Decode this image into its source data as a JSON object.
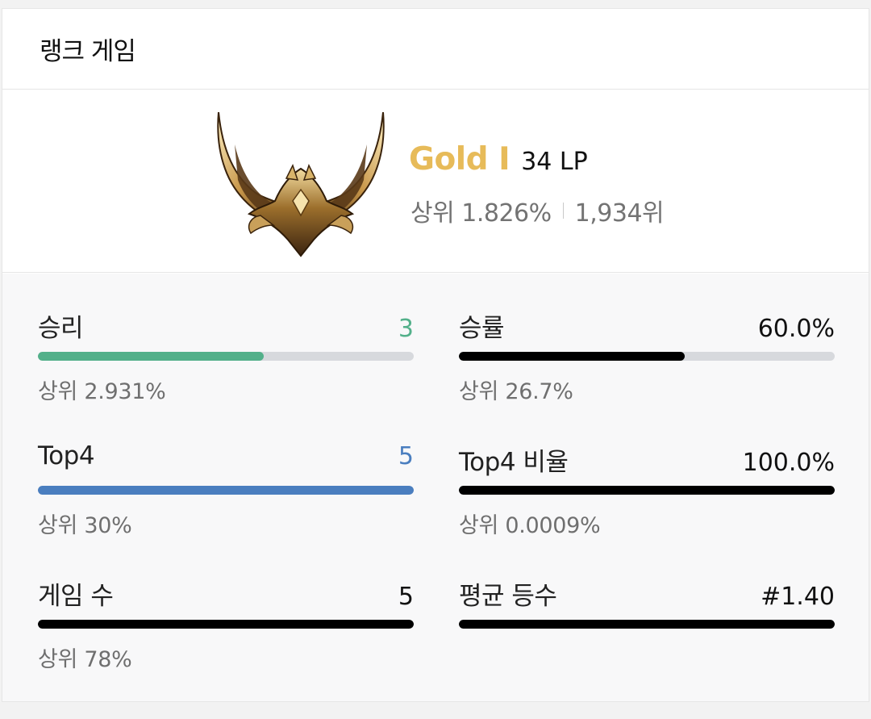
{
  "header": {
    "title": "랭크 게임"
  },
  "rank": {
    "emblem_icon": "gold-tier-emblem-icon",
    "tier": "Gold I",
    "lp": "34 LP",
    "percentile": "상위 1.826%",
    "position": "1,934위",
    "tier_color": "#e7bb59"
  },
  "stats": {
    "wins": {
      "label": "승리",
      "value": "3",
      "fill": 0.6,
      "sub": "상위 2.931%",
      "color": "#53b08a",
      "value_color": "#53b08a"
    },
    "win_rate": {
      "label": "승률",
      "value": "60.0%",
      "fill": 0.6,
      "sub": "상위 26.7%",
      "color": "#000000",
      "value_color": "#111111"
    },
    "top4": {
      "label": "Top4",
      "value": "5",
      "fill": 1.0,
      "sub": "상위 30%",
      "color": "#4a7ebf",
      "value_color": "#4a7ebf"
    },
    "top4_rate": {
      "label": "Top4 비율",
      "value": "100.0%",
      "fill": 1.0,
      "sub": "상위 0.0009%",
      "color": "#000000",
      "value_color": "#111111"
    },
    "games": {
      "label": "게임 수",
      "value": "5",
      "fill": 1.0,
      "sub": "상위 78%",
      "color": "#000000",
      "value_color": "#111111"
    },
    "avg_place": {
      "label": "평균 등수",
      "value": "#1.40",
      "fill": 1.0,
      "sub": "",
      "color": "#000000",
      "value_color": "#111111"
    }
  }
}
